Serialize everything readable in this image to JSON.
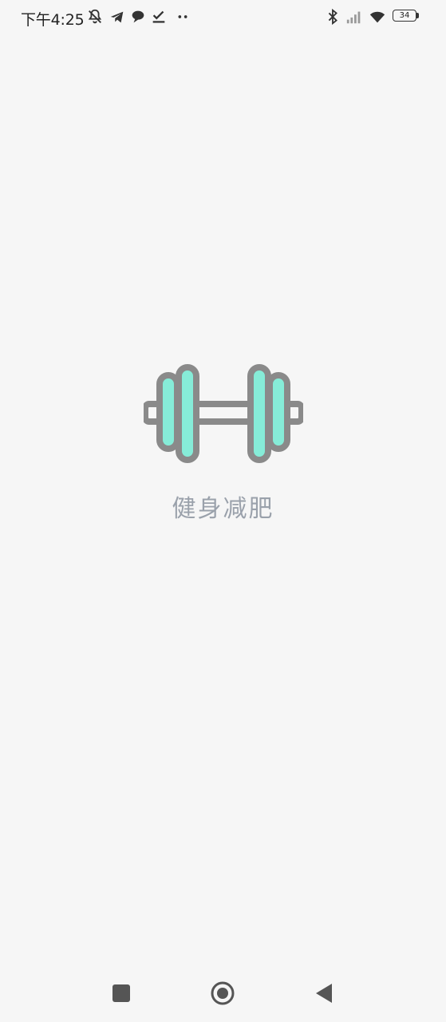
{
  "status_bar": {
    "time": "下午4:25",
    "icons": [
      "mute-notifications-icon",
      "telegram-icon",
      "chat-bubble-icon",
      "check-download-icon",
      "more-dots-icon",
      "bluetooth-icon",
      "cell-signal-icon",
      "wifi-icon",
      "battery-icon"
    ],
    "battery_level": "34"
  },
  "splash": {
    "logo_icon": "dumbbell-icon",
    "app_name": "健身减肥",
    "colors": {
      "background": "#f6f6f6",
      "logo_outline": "#8a8a8a",
      "logo_accent": "#86ecd8",
      "app_name_text": "#9aa1ab"
    }
  },
  "nav_bar": {
    "buttons": [
      "recents-icon",
      "home-icon",
      "back-icon"
    ]
  }
}
